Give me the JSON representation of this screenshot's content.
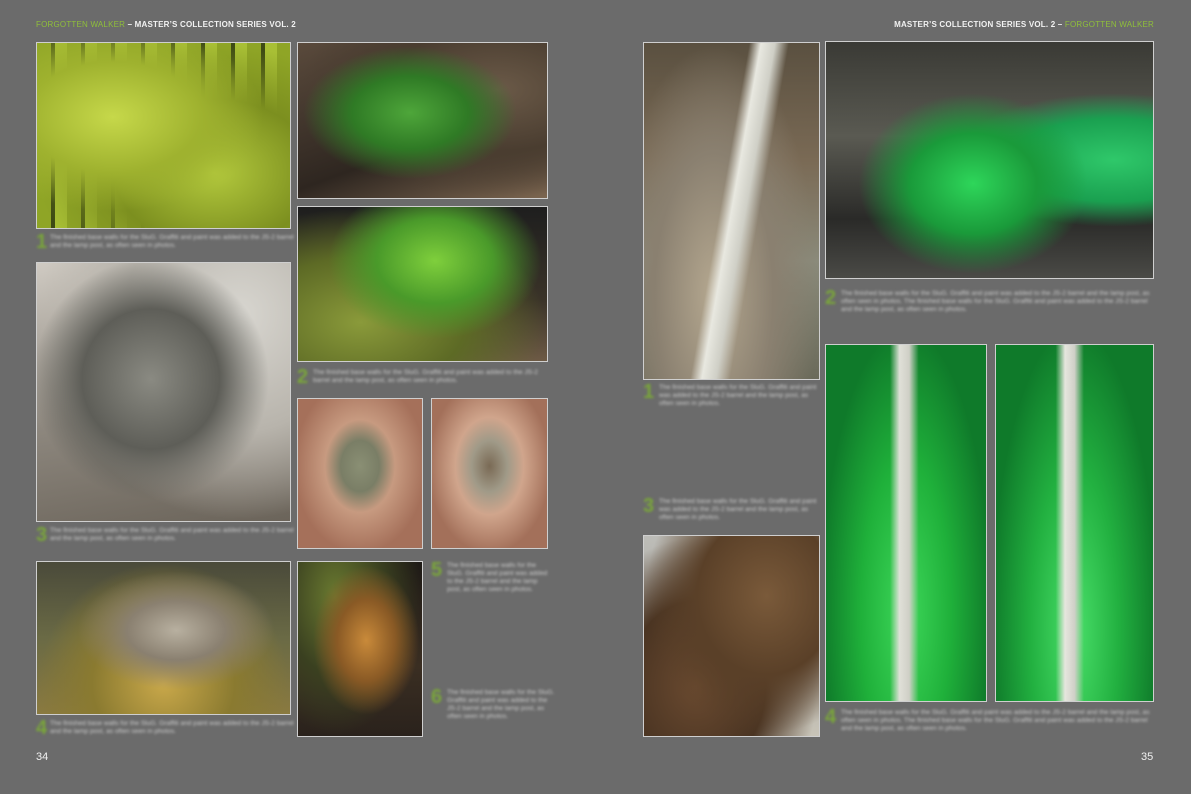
{
  "left_page": {
    "header_accent": "FORGOTTEN WALKER",
    "header_main": " – MASTER’S COLLECTION SERIES VOL. 2",
    "page_number": "34",
    "captions": [
      {
        "num": "1",
        "text": "The finished base walls for the SluG. Graffiti and paint was added to the JS-2 barrel and the lamp post, as often seen in photos."
      },
      {
        "num": "2",
        "text": "The finished base walls for the SluG. Graffiti and paint was added to the JS-2 barrel and the lamp post, as often seen in photos."
      },
      {
        "num": "3",
        "text": "The finished base walls for the SluG. Graffiti and paint was added to the JS-2 barrel and the lamp post, as often seen in photos."
      },
      {
        "num": "4",
        "text": "The finished base walls for the SluG. Graffiti and paint was added to the JS-2 barrel and the lamp post, as often seen in photos."
      },
      {
        "num": "5",
        "text": "The finished base walls for the SluG. Graffiti and paint was added to the JS-2 barrel and the lamp post, as often seen in photos."
      },
      {
        "num": "6",
        "text": "The finished base walls for the SluG. Graffiti and paint was added to the JS-2 barrel and the lamp post, as often seen in photos."
      }
    ]
  },
  "right_page": {
    "header_main": "MASTER’S COLLECTION SERIES VOL. 2 – ",
    "header_accent": "FORGOTTEN WALKER",
    "page_number": "35",
    "captions": [
      {
        "num": "1",
        "text": "The finished base walls for the SluG. Graffiti and paint was added to the JS-2 barrel and the lamp post, as often seen in photos."
      },
      {
        "num": "2",
        "text": "The finished base walls for the SluG. Graffiti and paint was added to the JS-2 barrel and the lamp post, as often seen in photos. The finished base walls for the SluG. Graffiti and paint was added to the JS-2 barrel and the lamp post, as often seen in photos."
      },
      {
        "num": "3",
        "text": "The finished base walls for the SluG. Graffiti and paint was added to the JS-2 barrel and the lamp post, as often seen in photos."
      },
      {
        "num": "4",
        "text": "The finished base walls for the SluG. Graffiti and paint was added to the JS-2 barrel and the lamp post, as often seen in photos. The finished base walls for the SluG. Graffiti and paint was added to the JS-2 barrel and the lamp post, as often seen in photos."
      }
    ]
  },
  "colors": {
    "accent": "#8fbf3a",
    "caption_number": "#7aa63a",
    "background": "#6b6b6b"
  }
}
